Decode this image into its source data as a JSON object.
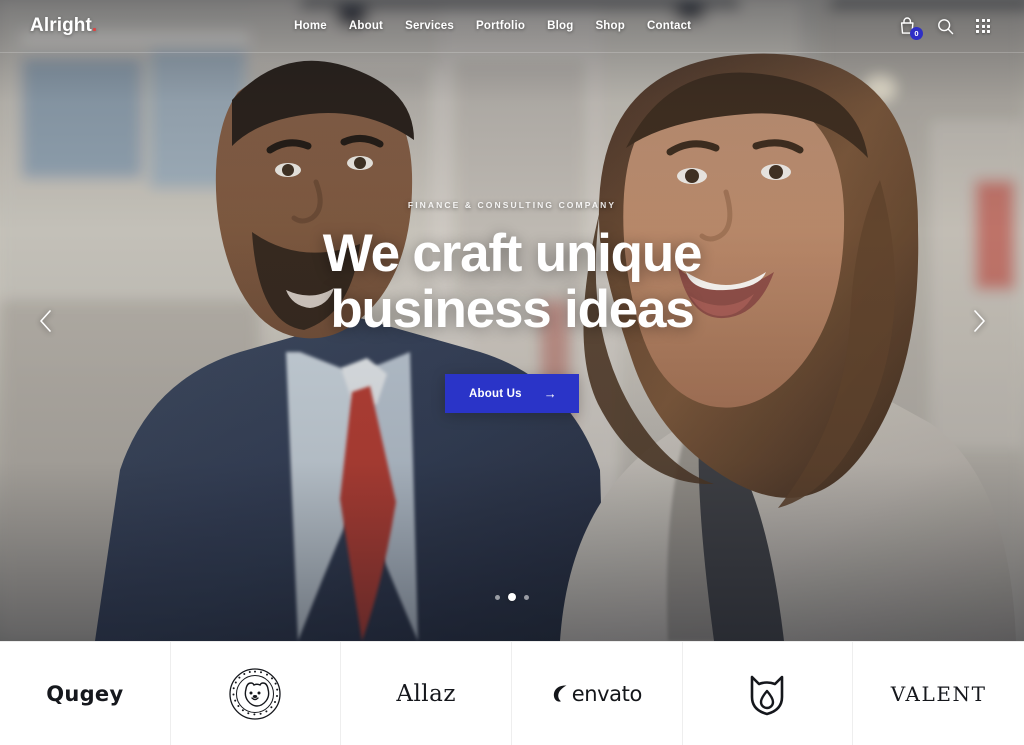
{
  "site": {
    "logo_text": "Alright",
    "logo_accent": ".",
    "accent_color": "#e0403f"
  },
  "header": {
    "nav": [
      {
        "label": "Home"
      },
      {
        "label": "About"
      },
      {
        "label": "Services"
      },
      {
        "label": "Portfolio"
      },
      {
        "label": "Blog"
      },
      {
        "label": "Shop"
      },
      {
        "label": "Contact"
      }
    ],
    "actions": {
      "cart_icon": "shopping-bag-icon",
      "cart_count": "0",
      "search_icon": "search-icon",
      "grid_icon": "grid-menu-icon"
    }
  },
  "hero": {
    "eyebrow": "FINANCE & CONSULTING COMPANY",
    "headline_line1": "We craft unique",
    "headline_line2": "business ideas",
    "cta_label": "About Us",
    "cta_arrow": "→",
    "cta_color": "#2a34c8",
    "prev_icon": "chevron-left-icon",
    "next_icon": "chevron-right-icon",
    "slides": [
      {
        "active": false
      },
      {
        "active": true
      },
      {
        "active": false
      }
    ]
  },
  "brands": [
    {
      "name": "Qugey",
      "style": "rounded"
    },
    {
      "name": "Bulldog badge",
      "style": "emblem"
    },
    {
      "name": "Allaz",
      "style": "serif"
    },
    {
      "name": "envato",
      "style": "envato"
    },
    {
      "name": "Shield mark",
      "style": "emblem"
    },
    {
      "name": "VALENT",
      "style": "serif-caps"
    }
  ]
}
